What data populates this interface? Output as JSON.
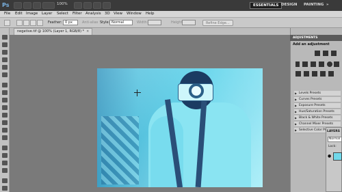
{
  "app": {
    "logo": "Ps",
    "zoom": "100%",
    "workspaces": [
      "ESSENTIALS",
      "DESIGN",
      "PAINTING",
      "»"
    ],
    "active_workspace": "ESSENTIALS"
  },
  "menu": [
    "File",
    "Edit",
    "Image",
    "Layer",
    "Select",
    "Filter",
    "Analysis",
    "3D",
    "View",
    "Window",
    "Help"
  ],
  "options": {
    "feather_label": "Feather:",
    "feather_value": "0 px",
    "antialias_label": "Anti-alias",
    "style_label": "Style:",
    "style_value": "Normal",
    "width_label": "Width:",
    "height_label": "Height:",
    "refine_edge": "Refine Edge..."
  },
  "document": {
    "tab_title": "negative.tif @ 100% (Layer 1, RGB/8) *",
    "close": "×"
  },
  "adjustments": {
    "header": "ADJUSTMENTS",
    "add_label": "Add an adjustment",
    "presets": [
      "Levels Presets",
      "Curves Presets",
      "Exposure Presets",
      "Hue/Saturation Presets",
      "Black & White Presets",
      "Channel Mixer Presets",
      "Selective Color Presets"
    ]
  },
  "layers": {
    "title": "LAYERS",
    "blend_mode": "Normal",
    "lock_label": "Lock:"
  }
}
